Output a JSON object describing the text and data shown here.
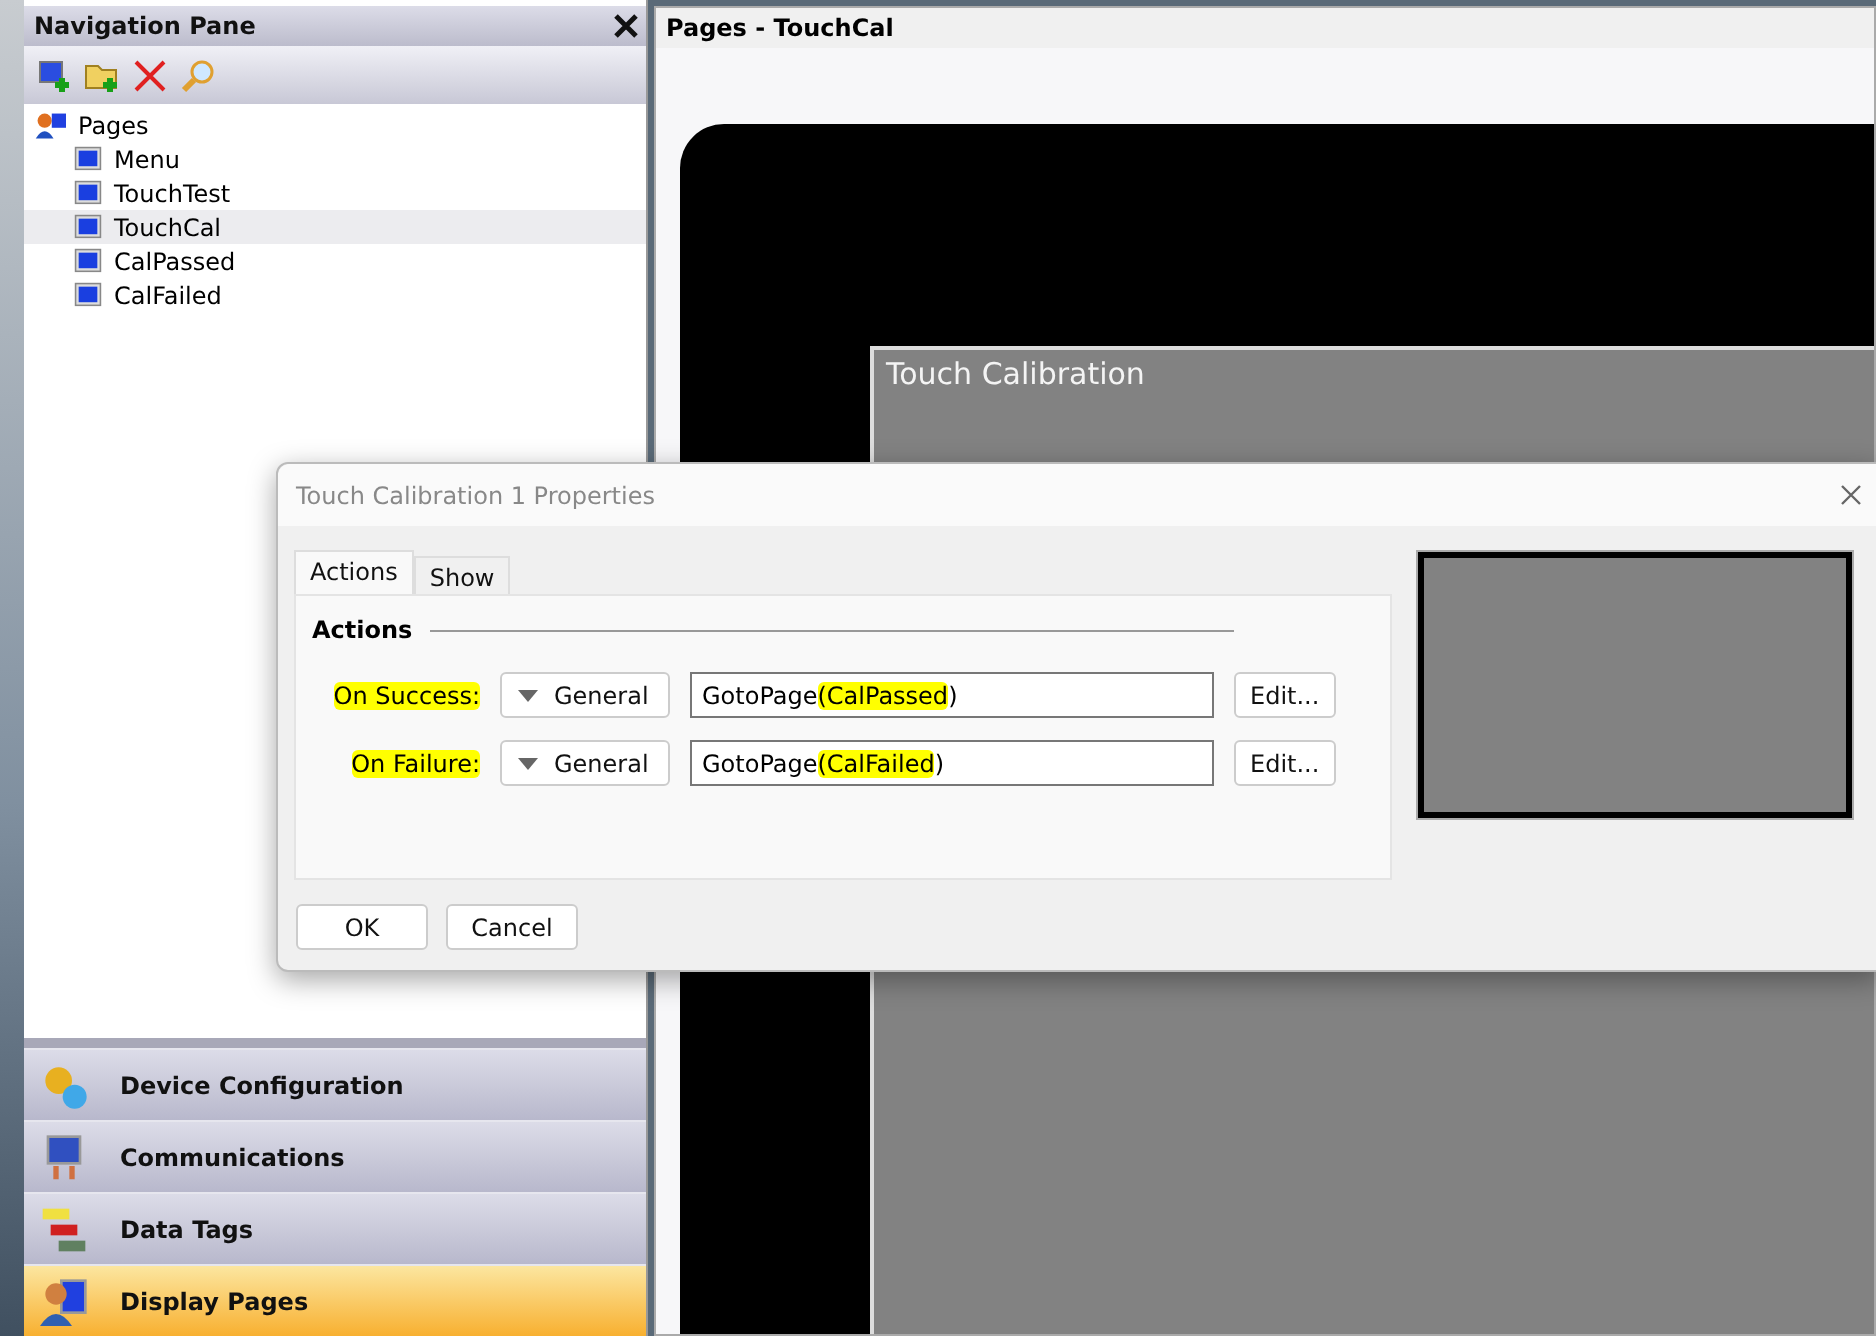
{
  "navigation_pane": {
    "title": "Navigation Pane",
    "tree": {
      "label": "Pages",
      "children": [
        {
          "label": "Menu",
          "selected": false
        },
        {
          "label": "TouchTest",
          "selected": false
        },
        {
          "label": "TouchCal",
          "selected": true
        },
        {
          "label": "CalPassed",
          "selected": false
        },
        {
          "label": "CalFailed",
          "selected": false
        }
      ]
    },
    "sections": [
      {
        "label": "Device Configuration",
        "kind": "gears",
        "selected": false
      },
      {
        "label": "Communications",
        "kind": "monitor",
        "selected": false
      },
      {
        "label": "Data Tags",
        "kind": "tags",
        "selected": false
      },
      {
        "label": "Display Pages",
        "kind": "pages",
        "selected": true
      }
    ]
  },
  "document": {
    "title": "Pages - TouchCal",
    "screen_title": "Touch Calibration"
  },
  "dialog": {
    "title": "Touch Calibration 1 Properties",
    "tabs": [
      {
        "label": "Actions",
        "selected": true
      },
      {
        "label": "Show",
        "selected": false
      }
    ],
    "group_title": "Actions",
    "actions": [
      {
        "label": "On Success:",
        "highlighted": true,
        "type": "General",
        "value_parts": [
          {
            "text": "GotoPage",
            "highlighted": false
          },
          {
            "text": "(CalPassed",
            "highlighted": true
          },
          {
            "text": ")",
            "highlighted": false
          }
        ],
        "button": "Edit..."
      },
      {
        "label": "On Failure:",
        "highlighted": true,
        "type": "General",
        "value_parts": [
          {
            "text": "GotoPage",
            "highlighted": false
          },
          {
            "text": "(CalFailed",
            "highlighted": true
          },
          {
            "text": ")",
            "highlighted": false
          }
        ],
        "button": "Edit..."
      }
    ],
    "buttons": [
      "OK",
      "Cancel"
    ]
  }
}
